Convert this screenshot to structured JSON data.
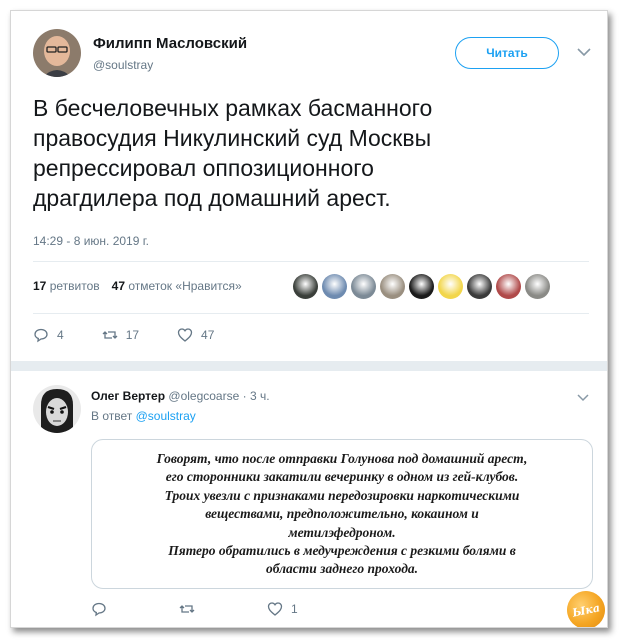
{
  "tweet": {
    "author_name": "Филипп Масловский",
    "author_handle": "@soulstray",
    "follow_label": "Читать",
    "text_lines": [
      "В бесчеловечных рамках басманного",
      "правосудия Никулинский суд Москвы",
      "репрессировал оппозиционного",
      "драгдилера под домашний арест."
    ],
    "timestamp": "14:29 - 8 июн. 2019 г.",
    "retweets_count": "17",
    "retweets_label": "ретвитов",
    "likes_count": "47",
    "likes_label": "отметок «Нравится»",
    "actions": {
      "reply": "4",
      "retweet": "17",
      "like": "47"
    },
    "liker_avatar_colors": [
      "#3a3f3a",
      "#6e8bb0",
      "#7c8a96",
      "#9a8f80",
      "#1b1b1b",
      "#f2d64b",
      "#3b3b3b",
      "#b04a4a",
      "#8a8a86"
    ]
  },
  "reply": {
    "author_name": "Олег Вертер",
    "author_handle": "@olegcoarse",
    "time_ago": "· 3 ч.",
    "reply_to_label": "В ответ",
    "reply_to_handle": "@soulstray",
    "quote_lines": [
      "Говорят, что после отправки Голунова под домашний арест,",
      "его сторонники закатили вечеринку в одном из гей-клубов.",
      "Троих увезли с признаками передозировки наркотическими",
      "веществами, предположительно, кокаином и",
      "метилэфедроном.",
      "Пятеро обратились в медучреждения с резкими болями в",
      "области заднего прохода."
    ],
    "actions": {
      "reply": "",
      "retweet": "",
      "like": "1"
    }
  },
  "watermark": {
    "text": "Ыка"
  },
  "colors": {
    "accent": "#1da1f2",
    "muted": "#657786",
    "divider": "#e6ecf0"
  }
}
